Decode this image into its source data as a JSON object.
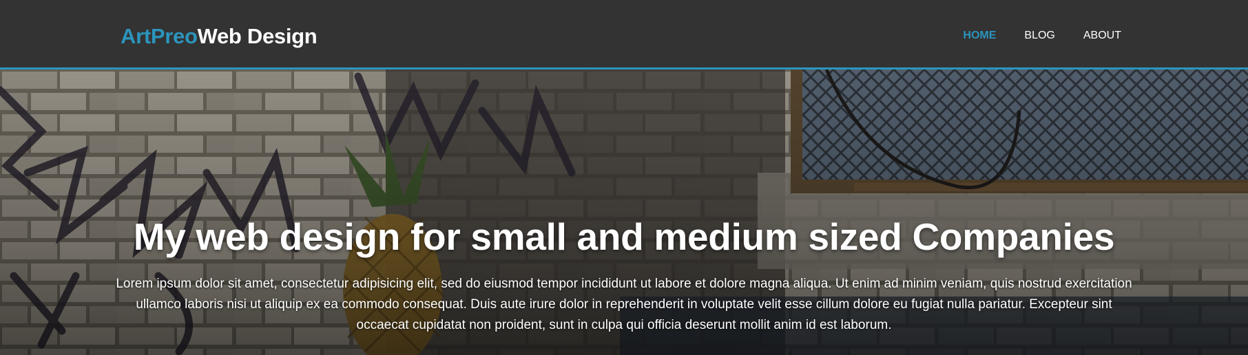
{
  "header": {
    "logo_accent": "ArtPreo",
    "logo_rest": "Web Design",
    "nav": [
      {
        "label": "HOME",
        "active": true
      },
      {
        "label": "BLOG",
        "active": false
      },
      {
        "label": "ABOUT",
        "active": false
      }
    ]
  },
  "hero": {
    "title": "My web design for small and medium sized Companies",
    "text": "Lorem ipsum dolor sit amet, consectetur adipisicing elit, sed do eiusmod tempor incididunt ut labore et dolore magna aliqua. Ut enim ad minim veniam, quis nostrud exercitation ullamco laboris nisi ut aliquip ex ea commodo consequat. Duis aute irure dolor in reprehenderit in voluptate velit esse cillum dolore eu fugiat nulla pariatur. Excepteur sint occaecat cupidatat non proident, sunt in culpa qui officia deserunt mollit anim id est laborum."
  },
  "colors": {
    "header_bg": "#333333",
    "accent": "#2b95bd",
    "text": "#ffffff"
  }
}
